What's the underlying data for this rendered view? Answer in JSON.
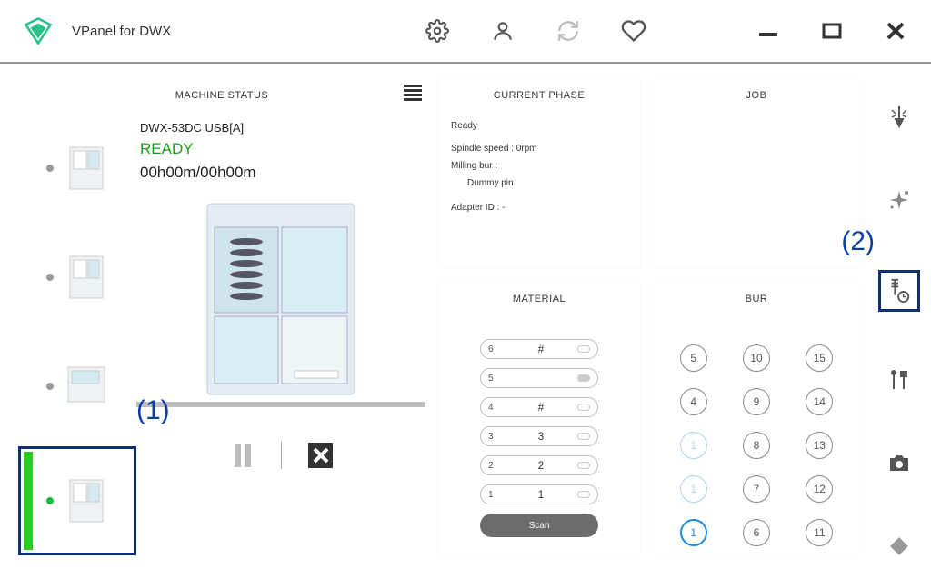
{
  "header": {
    "title": "VPanel for DWX"
  },
  "status_panel": {
    "header": "MACHINE STATUS",
    "callout1": "(1)",
    "callout2": "(2)"
  },
  "device": {
    "name": "DWX-53DC USB[A]",
    "status": "READY",
    "time": "00h00m/00h00m"
  },
  "phase": {
    "header": "CURRENT PHASE",
    "line1": "Ready",
    "line2": "Spindle speed : 0rpm",
    "line3": "Milling bur :",
    "line3b": "Dummy pin",
    "line4": "Adapter ID : -"
  },
  "job": {
    "header": "JOB"
  },
  "material": {
    "header": "MATERIAL",
    "rows": [
      {
        "idx": "6",
        "val": "#"
      },
      {
        "idx": "5",
        "val": ""
      },
      {
        "idx": "4",
        "val": "#"
      },
      {
        "idx": "3",
        "val": "3"
      },
      {
        "idx": "2",
        "val": "2"
      },
      {
        "idx": "1",
        "val": "1"
      }
    ],
    "scan_label": "Scan"
  },
  "bur": {
    "header": "BUR",
    "grid": [
      {
        "n": "5",
        "cls": ""
      },
      {
        "n": "10",
        "cls": ""
      },
      {
        "n": "15",
        "cls": ""
      },
      {
        "n": "4",
        "cls": ""
      },
      {
        "n": "9",
        "cls": ""
      },
      {
        "n": "14",
        "cls": ""
      },
      {
        "n": "1",
        "cls": "light"
      },
      {
        "n": "8",
        "cls": ""
      },
      {
        "n": "13",
        "cls": ""
      },
      {
        "n": "1",
        "cls": "light"
      },
      {
        "n": "7",
        "cls": ""
      },
      {
        "n": "12",
        "cls": ""
      },
      {
        "n": "1",
        "cls": "blue"
      },
      {
        "n": "6",
        "cls": ""
      },
      {
        "n": "11",
        "cls": ""
      }
    ]
  }
}
